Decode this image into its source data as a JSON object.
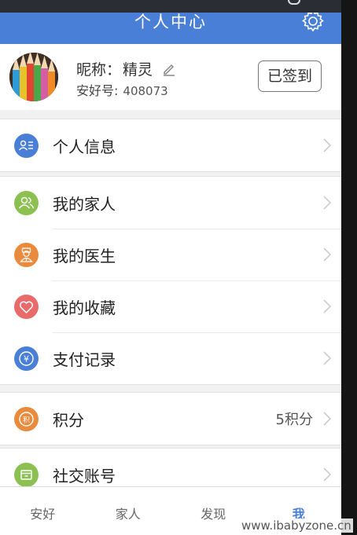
{
  "header": {
    "title": "个人中心"
  },
  "profile": {
    "nickname_label": "昵称：",
    "nickname": "精灵",
    "id_label": "安好号:",
    "id_value": "408073",
    "signed_label": "已签到"
  },
  "menu": {
    "personal_info": {
      "label": "个人信息",
      "icon": "id-card-icon",
      "color": "#4a7fd8"
    },
    "family": {
      "label": "我的家人",
      "icon": "people-icon",
      "color": "#8cc152"
    },
    "doctor": {
      "label": "我的医生",
      "icon": "doctor-icon",
      "color": "#e98a3c"
    },
    "favorites": {
      "label": "我的收藏",
      "icon": "heart-icon",
      "color": "#e96a6a"
    },
    "payments": {
      "label": "支付记录",
      "icon": "yen-icon",
      "color": "#4a7fd8"
    },
    "points": {
      "label": "积分",
      "value": "5积分",
      "icon": "points-icon",
      "color": "#e98a3c"
    },
    "social": {
      "label": "社交账号",
      "icon": "folder-icon",
      "color": "#8cc152"
    }
  },
  "tabs": [
    "安好",
    "家人",
    "发现",
    "我"
  ],
  "active_tab": "我",
  "watermark": "www.ibabyzone.cn"
}
